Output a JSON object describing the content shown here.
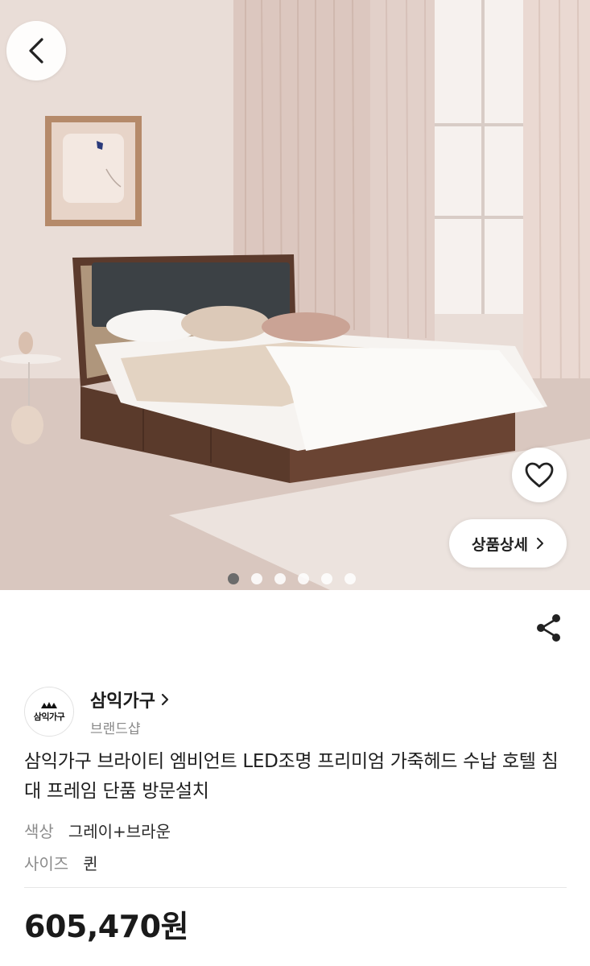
{
  "hero": {
    "image_alt": "brown wooden storage bed with gray leather LED headboard in a bedroom",
    "dots_count": 6,
    "active_dot": 0,
    "detail_button_label": "상품상세"
  },
  "icons": {
    "back": "chevron-left-icon",
    "wishlist": "heart-icon",
    "detail": "chevron-right-icon",
    "share": "share-icon"
  },
  "brand": {
    "name": "삼익가구",
    "subtitle": "브랜드샵",
    "logo_text": "삼익가구"
  },
  "product": {
    "title": "삼익가구 브라이티 엠비언트 LED조명 프리미엄 가죽헤드 수납 호텔 침대 프레임 단품 방문설치",
    "options": [
      {
        "label": "색상",
        "value": "그레이+브라운"
      },
      {
        "label": "사이즈",
        "value": "퀸"
      }
    ],
    "price": "605,470원"
  },
  "colors": {
    "headboard_gray": "#3c4145",
    "frame_brown": "#5b3a2c",
    "active_dot": "#6c6c6c"
  }
}
